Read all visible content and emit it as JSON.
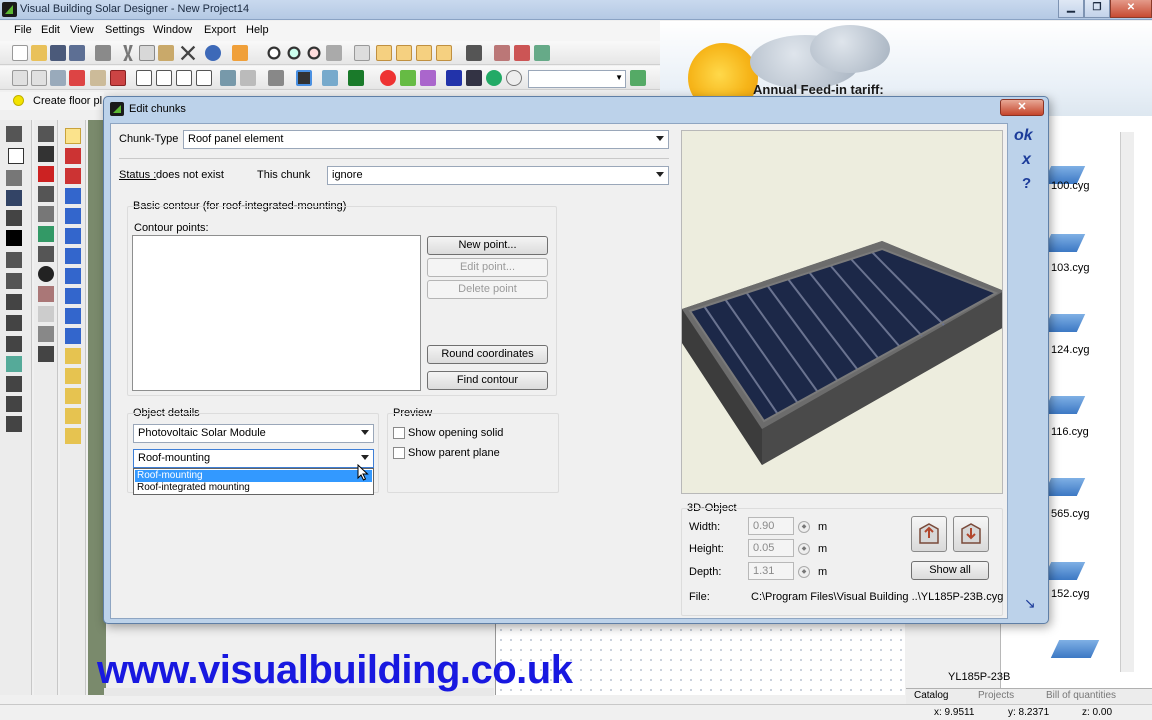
{
  "window": {
    "title": "Visual Building Solar Designer - New Project14",
    "min": "▁",
    "max": "❐",
    "close": "✕"
  },
  "menu": [
    "File",
    "Edit",
    "View",
    "Settings",
    "Window",
    "Export",
    "Help"
  ],
  "floorplan_hint": "Create floor pl",
  "banner": {
    "tariff_label": "Annual Feed-in tariff:"
  },
  "dialog": {
    "title": "Edit chunks",
    "close": "✕",
    "chunk_type_label": "Chunk-Type",
    "chunk_type_value": "Roof panel element",
    "status_label": "Status :",
    "status_value": "does not exist",
    "this_chunk_label": "This chunk",
    "this_chunk_value": "ignore",
    "basic_contour_title": "Basic contour (for roof-integrated-mounting)",
    "contour_points_label": "Contour points:",
    "buttons": {
      "new_point": "New point...",
      "edit_point": "Edit point...",
      "delete_point": "Delete point",
      "round_coordinates": "Round coordinates",
      "find_contour": "Find contour",
      "show_all": "Show all"
    },
    "object_details_label": "Object details",
    "object_type_value": "Photovoltaic Solar Module",
    "mounting_value": "Roof-mounting",
    "mounting_options": [
      "Roof-mounting",
      "Roof-integrated mounting"
    ],
    "preview_label": "Preview",
    "show_opening_solid": "Show opening solid",
    "show_parent_plane": "Show parent plane",
    "object3d_label": "3D-Object",
    "width_label": "Width:",
    "width_value": "0.90",
    "height_label": "Height:",
    "height_value": "0.05",
    "depth_label": "Depth:",
    "depth_value": "1.31",
    "unit": "m",
    "file_label": "File:",
    "file_value": "C:\\Program Files\\Visual Building ..\\YL185P-23B.cyg",
    "side": {
      "ok": "ok",
      "cancel": "x",
      "help": "?",
      "resize": "↘"
    }
  },
  "catalog": {
    "items": [
      "100.cyg",
      "103.cyg",
      "124.cyg",
      "116.cyg",
      "565.cyg",
      "152.cyg",
      "YL185P-23B"
    ],
    "tabs": [
      "Catalog",
      "Projects",
      "Bill of quantities"
    ]
  },
  "status": {
    "x": "x: 9.9511",
    "y": "y: 8.2371",
    "z": "z: 0.00"
  },
  "watermark": "www.visualbuilding.co.uk"
}
